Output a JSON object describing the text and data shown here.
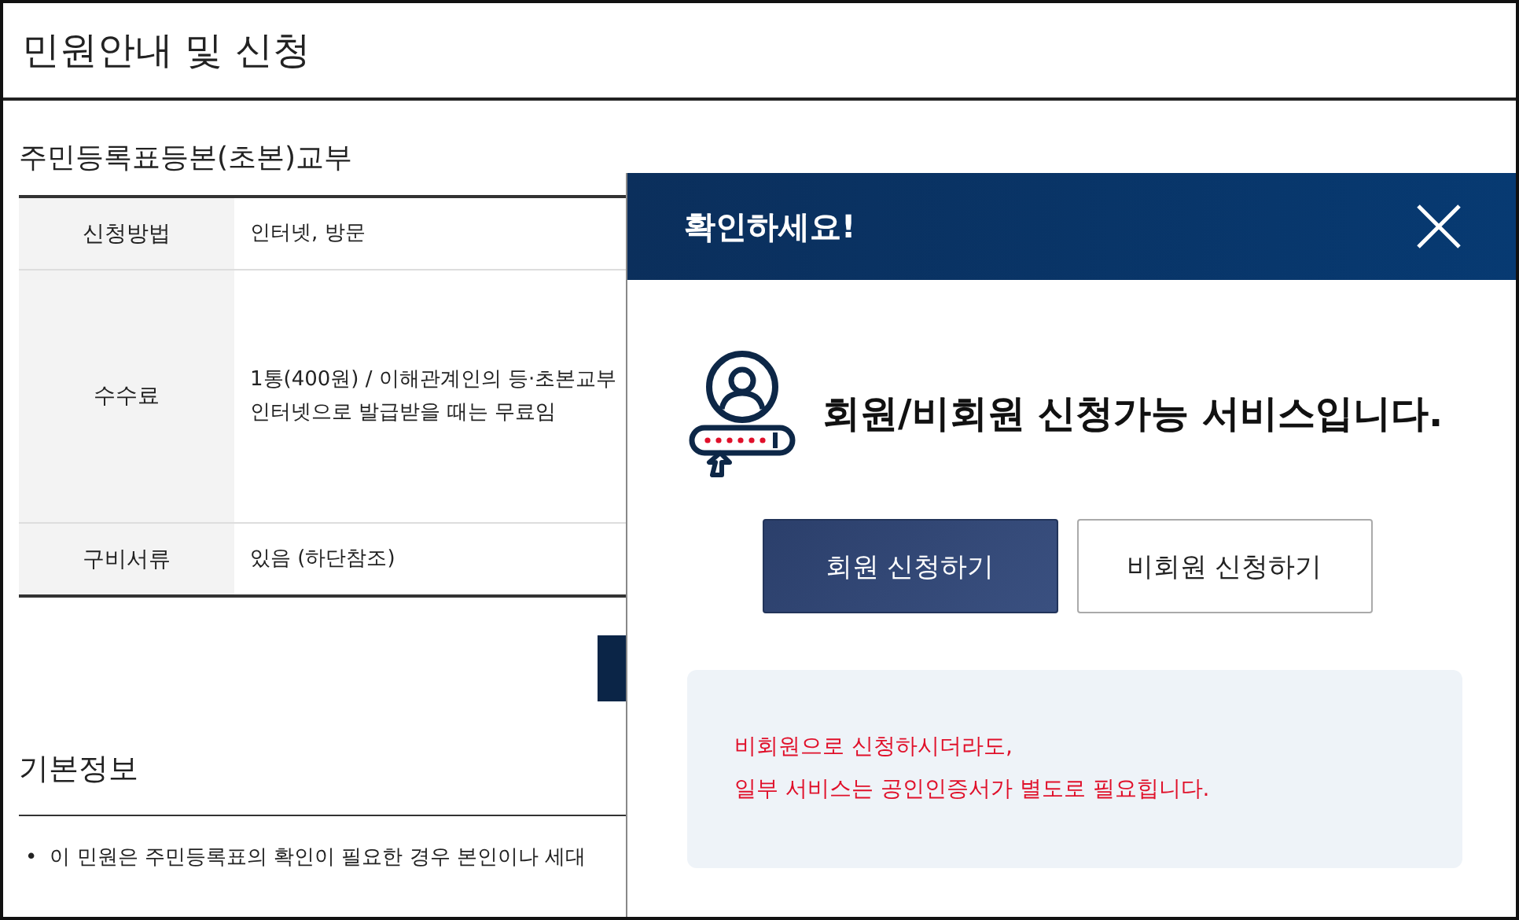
{
  "page": {
    "title": "민원안내 및 신청"
  },
  "service": {
    "title": "주민등록표등본(초본)교부",
    "rows": [
      {
        "label": "신청방법",
        "lines": [
          "인터넷, 방문"
        ]
      },
      {
        "label": "수수료",
        "lines": [
          "1통(400원) / 이해관계인의 등·초본교부",
          "인터넷으로 발급받을 때는 무료임"
        ]
      },
      {
        "label": "구비서류",
        "lines": [
          "있음 (하단참조)"
        ]
      }
    ]
  },
  "basic_info": {
    "title": "기본정보",
    "bullets": [
      {
        "marker": "•",
        "text": "이 민원은 주민등록표의 확인이 필요한 경우 본인이나 세대"
      }
    ]
  },
  "modal": {
    "title": "확인하세요!",
    "message": "회원/비회원 신청가능 서비스입니다.",
    "buttons": [
      {
        "label": "회원 신청하기",
        "kind": "primary"
      },
      {
        "label": "비회원 신청하기",
        "kind": "secondary"
      }
    ],
    "notice": [
      "비회원으로 신청하시더라도,",
      "일부 서비스는 공인인증서가 별도로 필요힙니다."
    ]
  }
}
